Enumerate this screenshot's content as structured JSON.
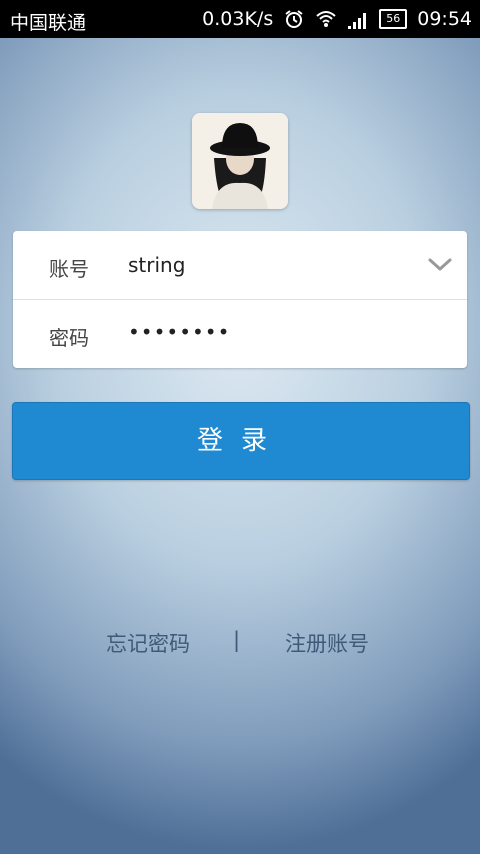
{
  "status_bar": {
    "carrier": "中国联通",
    "net_speed": "0.03K/s",
    "battery_level": "56",
    "time": "09:54",
    "icons": [
      "alarm-icon",
      "wifi-icon",
      "signal-icon",
      "battery-icon"
    ]
  },
  "login_form": {
    "account_label": "账号",
    "account_value": "string",
    "password_label": "密码",
    "password_value": "••••••••",
    "dropdown_icon": "chevron-down-icon"
  },
  "login_button_label": "登录",
  "links": {
    "forgot_password": "忘记密码",
    "separator": "|",
    "register": "注册账号"
  },
  "colors": {
    "accent": "#1f8ad2",
    "link_text": "#3f5a78"
  }
}
